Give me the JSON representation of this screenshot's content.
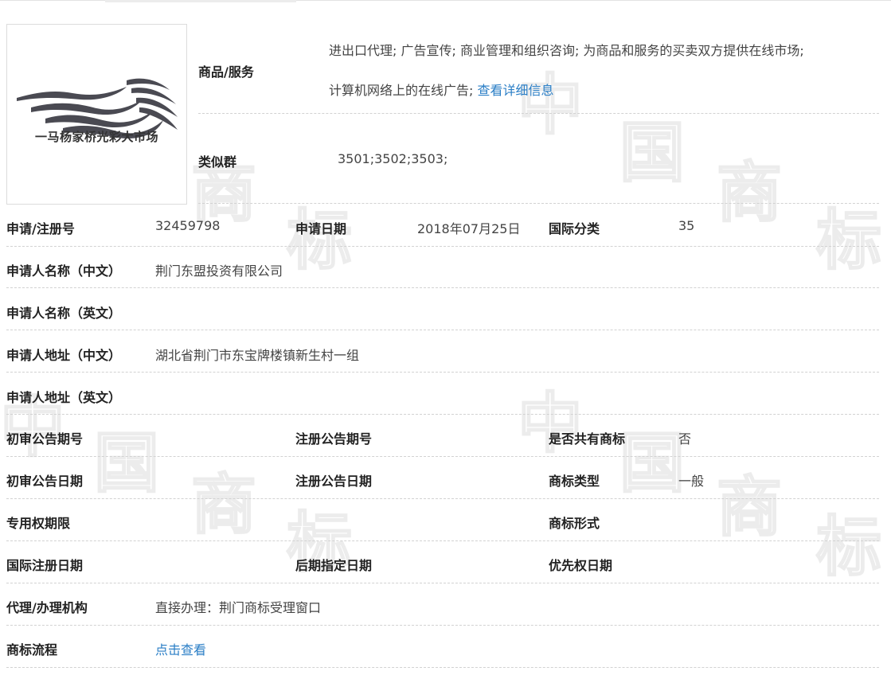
{
  "trademark": {
    "logo": {
      "caption": "一马杨家桥光彩大市场",
      "icon": "waves-logo-icon"
    },
    "goods_services": {
      "label": "商品/服务",
      "line1": "进出口代理; 广告宣传; 商业管理和组织咨询; 为商品和服务的买卖双方提供在线市场;",
      "line2": "计算机网络上的在线广告;",
      "detail_link": "查看详细信息"
    },
    "similar_group": {
      "label": "类似群",
      "value": "3501;3502;3503;"
    },
    "reg_no": {
      "label": "申请/注册号",
      "value": "32459798"
    },
    "apply_date": {
      "label": "申请日期",
      "value": "2018年07月25日"
    },
    "intl_class": {
      "label": "国际分类",
      "value": "35"
    },
    "applicant_cn": {
      "label": "申请人名称（中文）",
      "value": "荆门东盟投资有限公司"
    },
    "applicant_en": {
      "label": "申请人名称（英文）",
      "value": ""
    },
    "address_cn": {
      "label": "申请人地址（中文）",
      "value": "湖北省荆门市东宝牌楼镇新生村一组"
    },
    "address_en": {
      "label": "申请人地址（英文）",
      "value": ""
    },
    "prelim_pub_no": {
      "label": "初审公告期号",
      "value": ""
    },
    "reg_pub_no": {
      "label": "注册公告期号",
      "value": ""
    },
    "shared_mark": {
      "label": "是否共有商标",
      "value": "否"
    },
    "prelim_pub_date": {
      "label": "初审公告日期",
      "value": ""
    },
    "reg_pub_date": {
      "label": "注册公告日期",
      "value": ""
    },
    "mark_type": {
      "label": "商标类型",
      "value": "一般"
    },
    "exclusive_period": {
      "label": "专用权期限",
      "value": ""
    },
    "mark_form": {
      "label": "商标形式",
      "value": ""
    },
    "intl_reg_date": {
      "label": "国际注册日期",
      "value": ""
    },
    "later_designation_date": {
      "label": "后期指定日期",
      "value": ""
    },
    "priority_date": {
      "label": "优先权日期",
      "value": ""
    },
    "agency": {
      "label": "代理/办理机构",
      "value": "直接办理：荆门商标受理窗口"
    },
    "process": {
      "label": "商标流程",
      "link": "点击查看"
    }
  },
  "watermark": {
    "chars": [
      "中",
      "国",
      "商",
      "标"
    ]
  },
  "colors": {
    "link": "#2a7ec6",
    "label": "#222222",
    "value": "#444444",
    "separator": "#d2d2d2"
  }
}
